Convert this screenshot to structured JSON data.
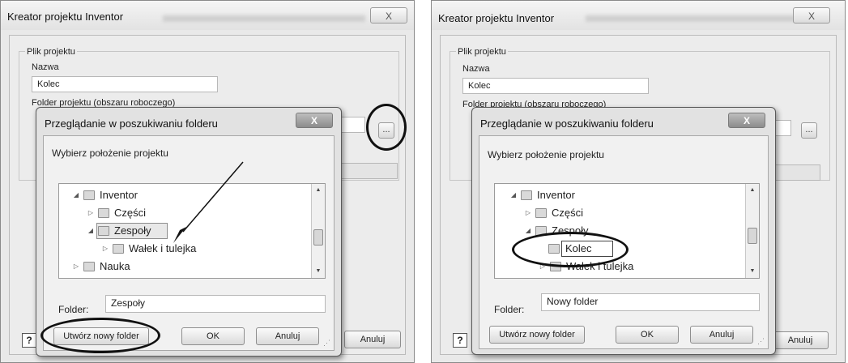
{
  "wizard": {
    "title": "Kreator projektu Inventor",
    "close_glyph": "X",
    "group_label": "Plik projektu",
    "name_label": "Nazwa",
    "name_value": "Kolec",
    "folder_label": "Folder projektu (obszaru roboczego)",
    "browse_label": "...",
    "help_glyph": "?",
    "cancel_label": "Anuluj"
  },
  "browse_dialog": {
    "title": "Przeglądanie w poszukiwaniu folderu",
    "close_glyph": "X",
    "prompt": "Wybierz położenie projektu",
    "folder_label": "Folder:",
    "new_folder_button": "Utwórz nowy folder",
    "ok_button": "OK",
    "cancel_button": "Anuluj"
  },
  "left_panel": {
    "tree": [
      {
        "label": "Inventor",
        "level": 0,
        "expander": "expanded"
      },
      {
        "label": "Części",
        "level": 1,
        "expander": "collapsed"
      },
      {
        "label": "Zespoły",
        "level": 1,
        "expander": "expanded",
        "selected": true
      },
      {
        "label": "Wałek i tulejka",
        "level": 2,
        "expander": "collapsed"
      },
      {
        "label": "Nauka",
        "level": 0,
        "expander": "collapsed"
      }
    ],
    "folder_value": "Zespoły"
  },
  "right_panel": {
    "tree": [
      {
        "label": "Inventor",
        "level": 0,
        "expander": "expanded"
      },
      {
        "label": "Części",
        "level": 1,
        "expander": "collapsed"
      },
      {
        "label": "Zespoły",
        "level": 1,
        "expander": "expanded"
      },
      {
        "label": "Wałek i tulejka",
        "level": 2,
        "expander": "collapsed"
      }
    ],
    "new_item_value": "Kolec",
    "folder_value": "Nowy folder"
  },
  "icons": {
    "folder": "folder-icon",
    "expanded": "expanded-arrow-icon",
    "collapsed": "collapsed-arrow-icon",
    "help": "help-icon"
  }
}
